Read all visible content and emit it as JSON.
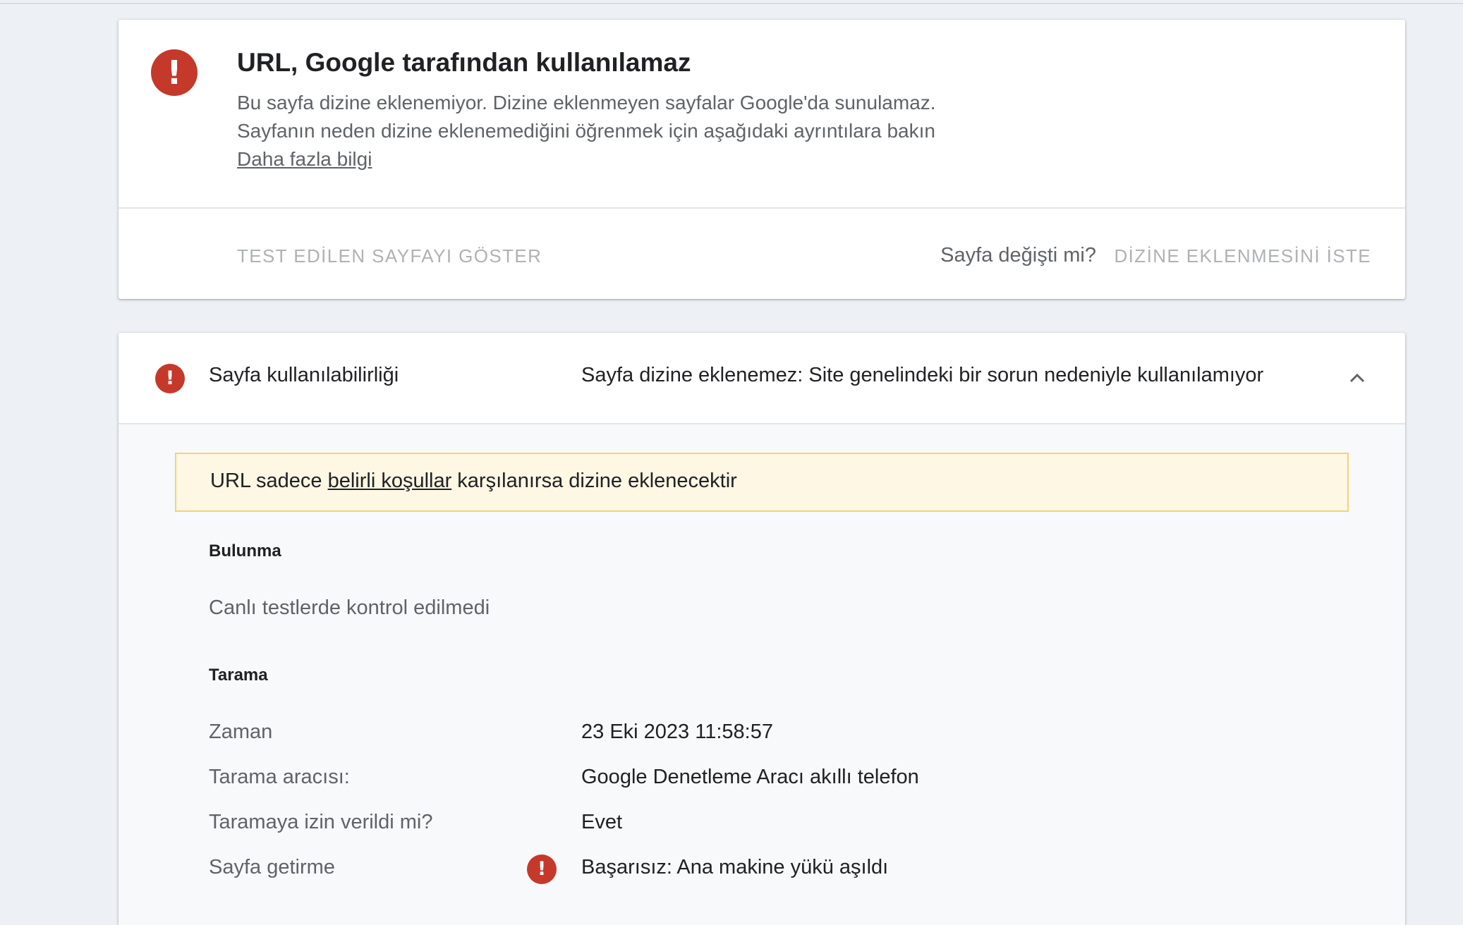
{
  "verdict": {
    "title": "URL, Google tarafından kullanılamaz",
    "line1": "Bu sayfa dizine eklenemiyor. Dizine eklenmeyen sayfalar Google'da sunulamaz.",
    "line2": "Sayfanın neden dizine eklenemediğini öğrenmek için aşağıdaki ayrıntılara bakın",
    "learn_more": "Daha fazla bilgi",
    "view_tested_page": "TEST EDİLEN SAYFAYI GÖSTER",
    "page_changed_question": "Sayfa değişti mi?",
    "request_indexing": "DİZİNE EKLENMESİNİ İSTE",
    "icon": "error-icon"
  },
  "availability": {
    "name": "Sayfa kullanılabilirliği",
    "status": "Sayfa dizine eklenemez: Site genelindeki bir sorun nedeniyle kullanılamıyor",
    "icon": "error-icon",
    "notice": {
      "before": "URL sadece ",
      "link": "belirli koşullar",
      "after": " karşılanırsa dizine eklenecektir"
    },
    "discovery": {
      "title": "Bulunma",
      "text": "Canlı testlerde kontrol edilmedi"
    },
    "crawl": {
      "title": "Tarama",
      "rows": [
        {
          "label": "Zaman",
          "value": "23 Eki 2023 11:58:57"
        },
        {
          "label": "Tarama aracısı:",
          "value": "Google Denetleme Aracı akıllı telefon"
        },
        {
          "label": "Taramaya izin verildi mi?",
          "value": "Evet"
        },
        {
          "label": "Sayfa getirme",
          "value": "Başarısız: Ana makine yükü aşıldı",
          "status": "error"
        }
      ]
    }
  },
  "colors": {
    "error": "#c5392b",
    "notice_bg": "#fdf7e4",
    "notice_border": "#f3d37a",
    "page_bg": "#edf1f5"
  }
}
